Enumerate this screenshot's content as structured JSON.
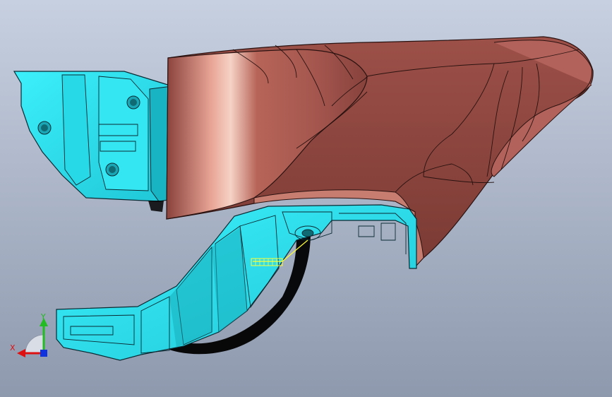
{
  "viewport": {
    "background_top": "#c7d0e0",
    "background_bottom": "#8e99ae"
  },
  "model": {
    "cover_part": {
      "icon": "curved-cover-shell",
      "color": "#a8574f",
      "highlight": "#f2c1b4",
      "shade": "#6e322d"
    },
    "bracket_part": {
      "icon": "mounting-bracket",
      "color": "#2ee6f2",
      "shade": "#1aa6b4"
    },
    "shadow_color": "#000000",
    "annotation_color": "#ffff33"
  },
  "triad": {
    "x_label": "X",
    "y_label": "Y",
    "x_color": "#dd1111",
    "y_color": "#22bb22",
    "z_color": "#1133dd"
  }
}
